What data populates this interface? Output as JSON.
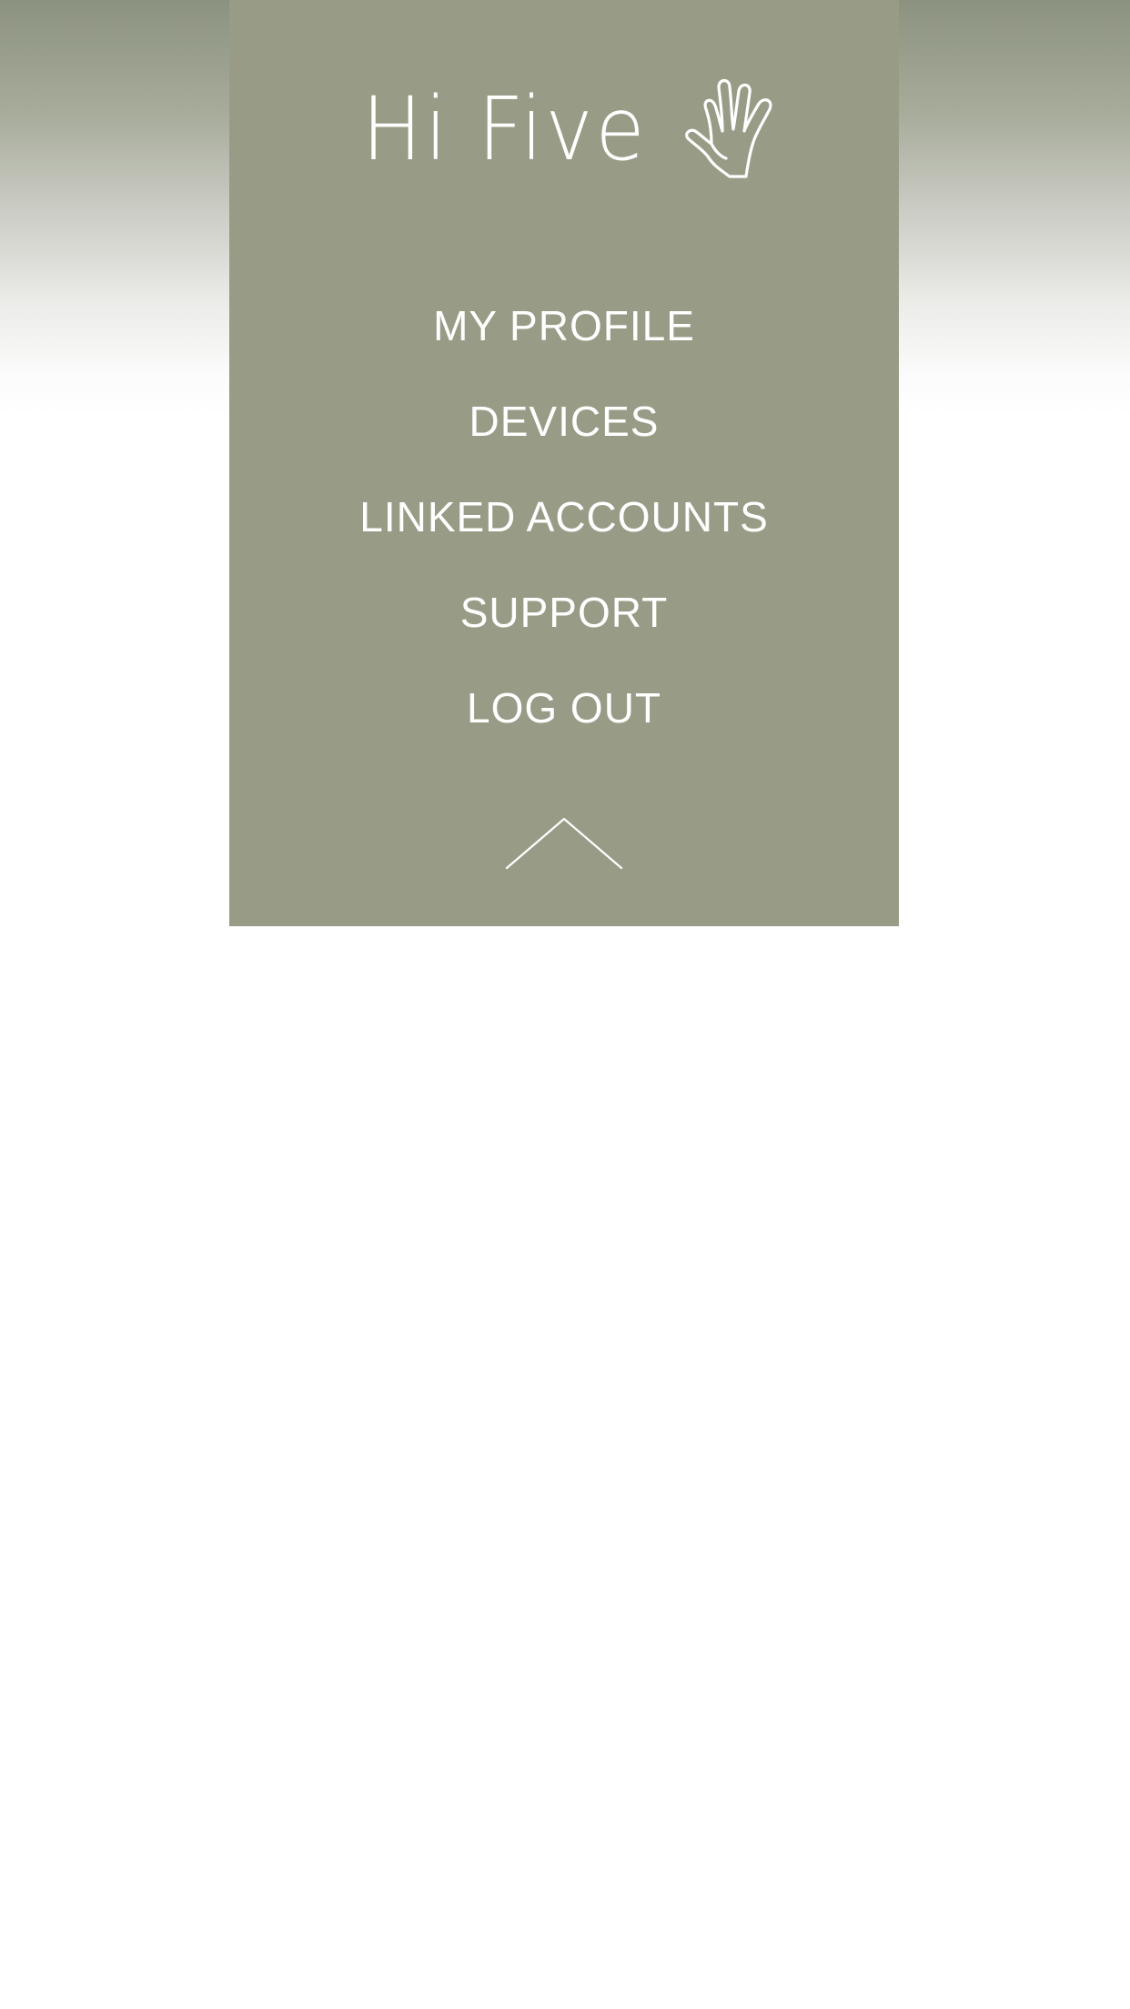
{
  "app": {
    "title": "Hi Five",
    "logo_icon": "raised-hand-icon"
  },
  "menu": {
    "items": [
      {
        "label": "MY PROFILE"
      },
      {
        "label": "DEVICES"
      },
      {
        "label": "LINKED ACCOUNTS"
      },
      {
        "label": "SUPPORT"
      },
      {
        "label": "LOG OUT"
      }
    ],
    "collapse_icon": "chevron-up-icon"
  },
  "colors": {
    "panel": "#989c86",
    "gradient_top": "#8c9280",
    "text": "#ffffff",
    "background": "#ffffff"
  }
}
